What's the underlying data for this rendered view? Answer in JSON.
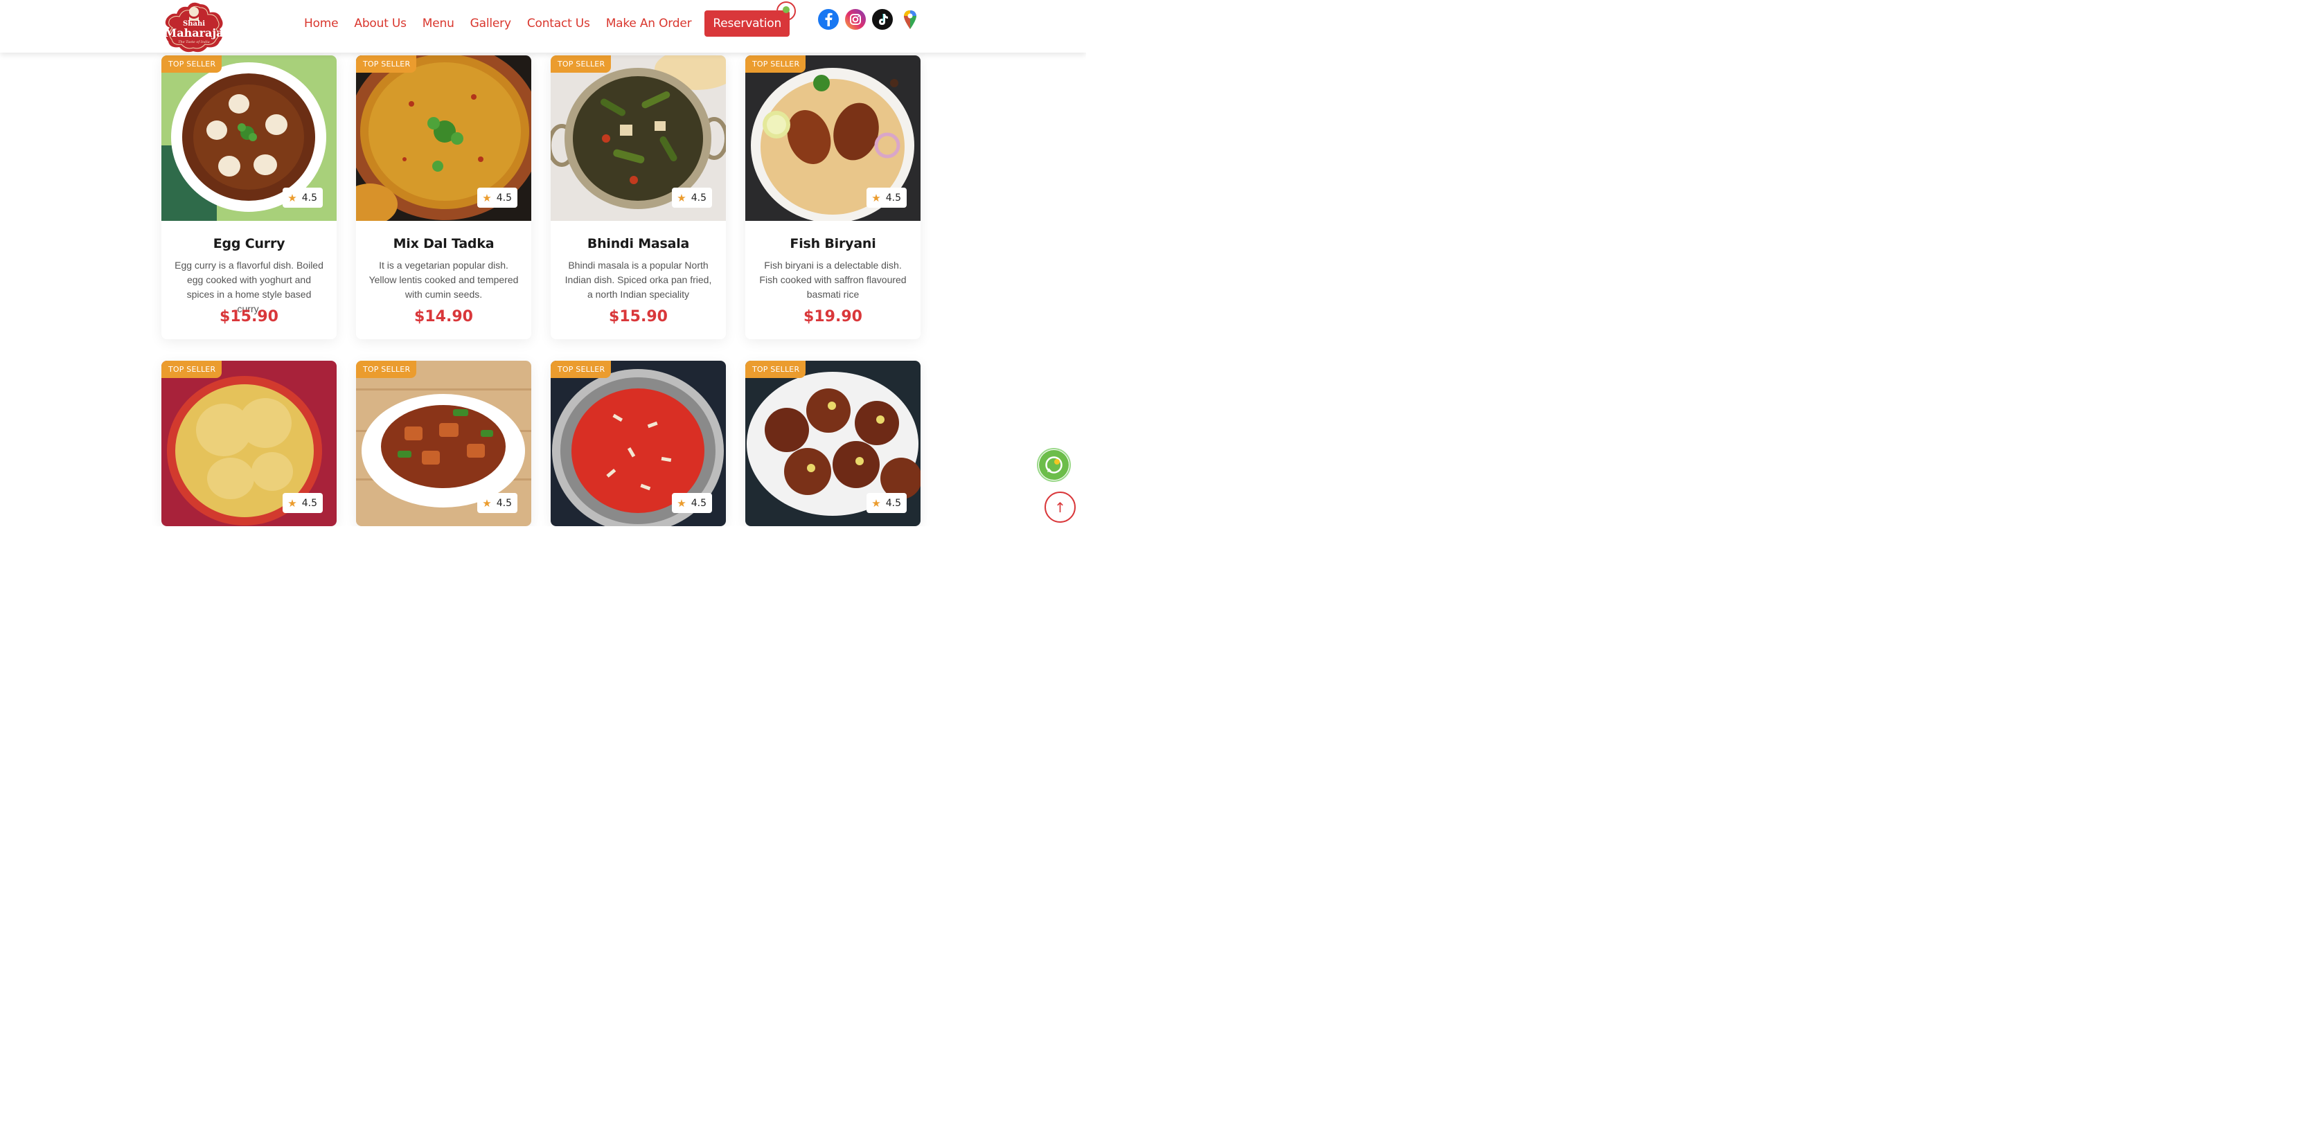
{
  "brand": {
    "name_line1": "Shahi",
    "name_line2": "Maharaja",
    "tagline": "The Taste of India",
    "color_primary": "#d9373a",
    "color_accent": "#eb9c2e"
  },
  "nav": {
    "items": [
      {
        "label": "Home"
      },
      {
        "label": "About Us"
      },
      {
        "label": "Menu"
      },
      {
        "label": "Gallery"
      },
      {
        "label": "Contact Us"
      },
      {
        "label": "Make An Order"
      }
    ],
    "reservation_label": "Reservation"
  },
  "social": [
    "facebook-icon",
    "instagram-icon",
    "tiktok-icon",
    "maps-pin-icon"
  ],
  "cards": [
    {
      "badge": "TOP SELLER",
      "rating": "4.5",
      "title": "Egg Curry",
      "desc": "Egg curry is a flavorful dish. Boiled egg cooked with yoghurt and spices in a home style based curry.",
      "price": "$15.90"
    },
    {
      "badge": "TOP SELLER",
      "rating": "4.5",
      "title": "Mix Dal Tadka",
      "desc": "It is a vegetarian popular dish. Yellow lentis cooked and tempered with cumin seeds.",
      "price": "$14.90"
    },
    {
      "badge": "TOP SELLER",
      "rating": "4.5",
      "title": "Bhindi Masala",
      "desc": "Bhindi masala is a popular North Indian dish. Spiced orka pan fried, a north Indian speciality",
      "price": "$15.90"
    },
    {
      "badge": "TOP SELLER",
      "rating": "4.5",
      "title": "Fish Biryani",
      "desc": "Fish biryani is a delectable dish. Fish cooked with saffron flavoured basmati rice",
      "price": "$19.90"
    },
    {
      "badge": "TOP SELLER",
      "rating": "4.5"
    },
    {
      "badge": "TOP SELLER",
      "rating": "4.5"
    },
    {
      "badge": "TOP SELLER",
      "rating": "4.5"
    },
    {
      "badge": "TOP SELLER",
      "rating": "4.5"
    }
  ],
  "floating": {
    "whatsapp_icon": "whatsapp-icon",
    "scroll_top_icon": "arrow-up-icon"
  }
}
